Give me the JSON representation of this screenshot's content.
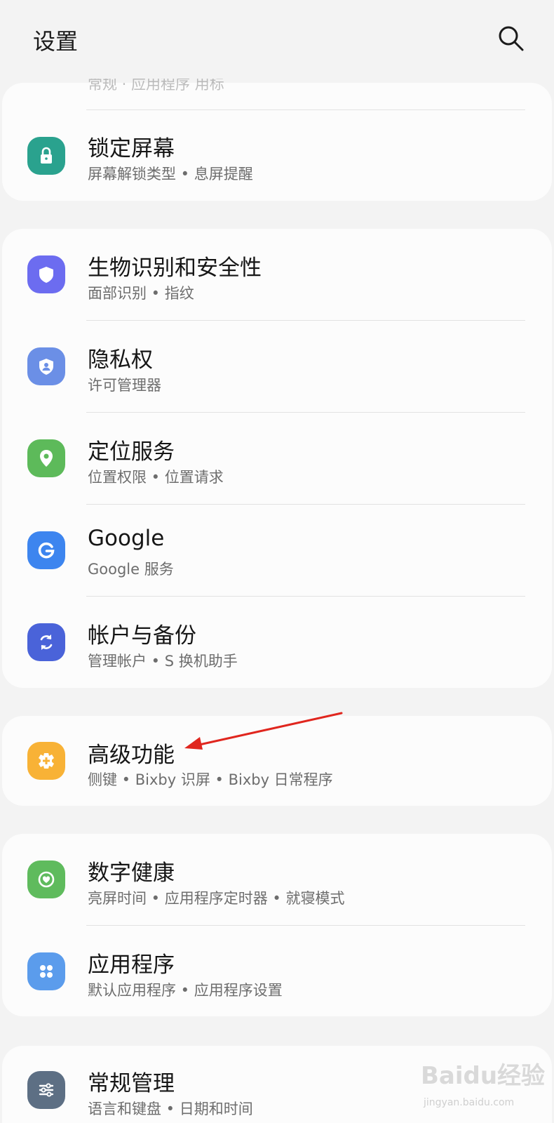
{
  "header": {
    "title": "设置",
    "search_icon": "search-icon"
  },
  "partial_top": {
    "sub": "常规 · 应用程序 用标"
  },
  "items": [
    {
      "id": "lock-screen",
      "label": "锁定屏幕",
      "sub": "屏幕解锁类型 • 息屏提醒",
      "icon": "lock-icon",
      "color": "#2aa28e"
    },
    {
      "id": "biometrics",
      "label": "生物识别和安全性",
      "sub": "面部识别 • 指纹",
      "icon": "shield-icon",
      "color": "#6c6cf0"
    },
    {
      "id": "privacy",
      "label": "隐私权",
      "sub": "许可管理器",
      "icon": "privacy-shield-icon",
      "color": "#6b8fe6"
    },
    {
      "id": "location",
      "label": "定位服务",
      "sub": "位置权限 • 位置请求",
      "icon": "location-pin-icon",
      "color": "#5dba5a"
    },
    {
      "id": "google",
      "label": "Google",
      "sub": "Google 服务",
      "icon": "google-icon",
      "color": "#3d85ef"
    },
    {
      "id": "accounts",
      "label": "帐户与备份",
      "sub": "管理帐户 • S 换机助手",
      "icon": "sync-icon",
      "color": "#4a63d9"
    },
    {
      "id": "advanced",
      "label": "高级功能",
      "sub": "侧键 • Bixby 识屏 • Bixby 日常程序",
      "icon": "gear-plus-icon",
      "color": "#f8b236"
    },
    {
      "id": "wellbeing",
      "label": "数字健康",
      "sub": "亮屏时间 • 应用程序定时器 • 就寝模式",
      "icon": "heart-ring-icon",
      "color": "#5fbb5d"
    },
    {
      "id": "apps",
      "label": "应用程序",
      "sub": "默认应用程序 • 应用程序设置",
      "icon": "apps-grid-icon",
      "color": "#5b9cec"
    },
    {
      "id": "general",
      "label": "常规管理",
      "sub": "语言和键盘 • 日期和时间",
      "icon": "sliders-icon",
      "color": "#5d6f84"
    }
  ],
  "watermark": {
    "logo": "Baidu经验",
    "url": "jingyan.baidu.com"
  },
  "annotation": {
    "arrow_color": "#e0261e"
  }
}
